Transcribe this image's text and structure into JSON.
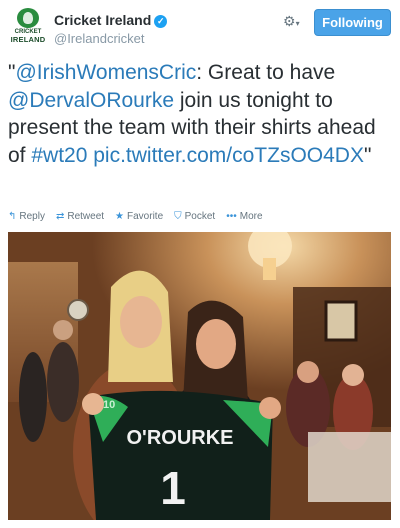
{
  "account": {
    "name": "Cricket Ireland",
    "handle": "@Irelandcricket",
    "logo_text_top": "CRICKET",
    "logo_text_bottom": "IRELAND",
    "verified_icon": "check-icon"
  },
  "header": {
    "follow_label": "Following",
    "settings_icon": "gear-icon"
  },
  "tweet": {
    "open_quote": "\"",
    "mention1": "@IrishWomensCric",
    "text1": ": Great to have ",
    "mention2": "@DervalORourke",
    "text2": " join us tonight to present the team with their shirts ahead of ",
    "hashtag": "#wt20",
    "space": " ",
    "link": "pic.twitter.com/coTZsOO4DX",
    "close_quote": "\""
  },
  "actions": [
    {
      "icon": "reply-icon",
      "label": "Reply",
      "glyph": "↰"
    },
    {
      "icon": "retweet-icon",
      "label": "Retweet",
      "glyph": "⇄"
    },
    {
      "icon": "star-icon",
      "label": "Favorite",
      "glyph": "★"
    },
    {
      "icon": "pocket-icon",
      "label": "Pocket",
      "glyph": "⛉"
    },
    {
      "icon": "more-icon",
      "label": "More",
      "glyph": "•••"
    }
  ],
  "photo": {
    "shirt_name": "O'ROURKE",
    "shirt_number": "1",
    "shirt_collar_number": "10"
  },
  "colors": {
    "link": "#2b7bb9",
    "follow_button": "#4aa3e8",
    "accent_icon": "#3b94d9",
    "logo_green": "#2a8c3f"
  }
}
